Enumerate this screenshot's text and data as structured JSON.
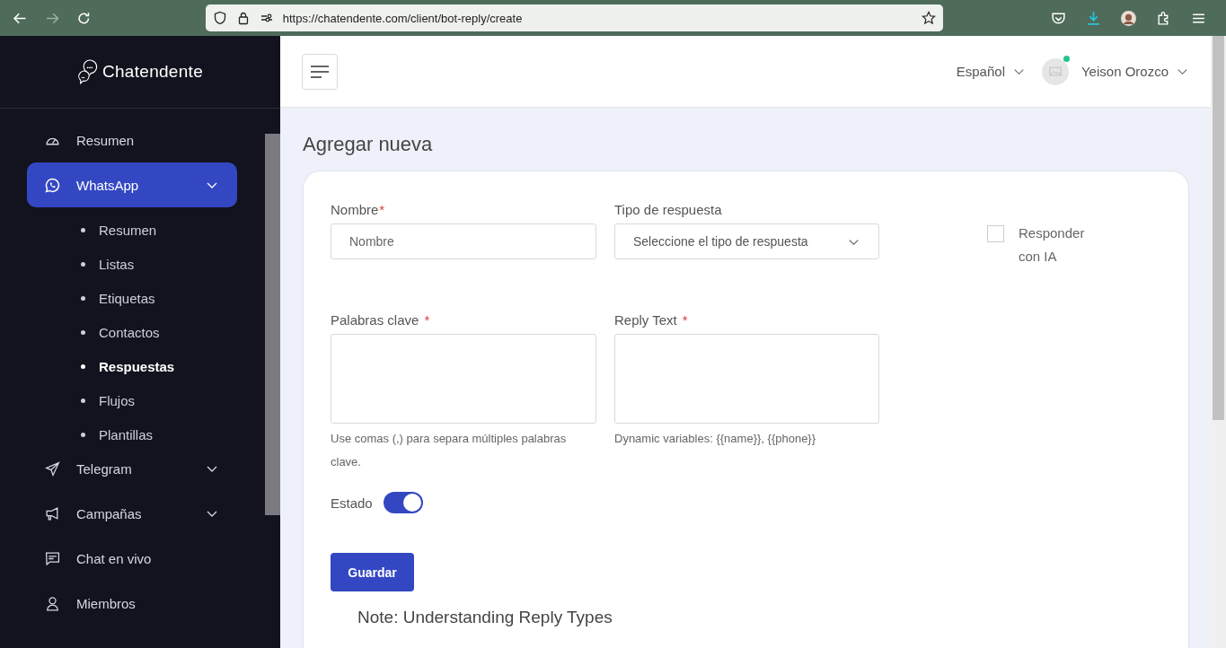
{
  "browser": {
    "url": "https://chatendente.com/client/bot-reply/create",
    "forward_disabled": true
  },
  "sidebar": {
    "logo": "Chatendente",
    "items": [
      {
        "label": "Resumen",
        "selected": false,
        "kind": "link"
      },
      {
        "label": "WhatsApp",
        "selected": true,
        "kind": "group",
        "children": [
          {
            "label": "Resumen",
            "selected": false
          },
          {
            "label": "Listas",
            "selected": false
          },
          {
            "label": "Etiquetas",
            "selected": false
          },
          {
            "label": "Contactos",
            "selected": false
          },
          {
            "label": "Respuestas",
            "selected": true
          },
          {
            "label": "Flujos",
            "selected": false
          },
          {
            "label": "Plantillas",
            "selected": false
          }
        ]
      },
      {
        "label": "Telegram",
        "selected": false,
        "kind": "group"
      },
      {
        "label": "Campañas",
        "selected": false,
        "kind": "group"
      },
      {
        "label": "Chat en vivo",
        "selected": false,
        "kind": "link"
      },
      {
        "label": "Miembros",
        "selected": false,
        "kind": "link"
      }
    ]
  },
  "header": {
    "language": "Español",
    "user": "Yeison Orozco",
    "online": true
  },
  "page": {
    "title": "Agregar nueva"
  },
  "form": {
    "fields": [
      {
        "kind": "text",
        "label": "Nombre",
        "required_mark": "*",
        "placeholder": "Nombre"
      },
      {
        "kind": "select",
        "label": "Tipo de respuesta",
        "placeholder": "Seleccione el tipo de respuesta"
      },
      {
        "kind": "checkbox",
        "label": "Responder con IA",
        "checked": false
      },
      {
        "kind": "textarea",
        "label": "Palabras clave",
        "required_mark": "*",
        "hint": "Use comas (,) para separa múltiples palabras clave."
      },
      {
        "kind": "textarea",
        "label": "Reply Text",
        "required_mark": "*",
        "hint": "Dynamic variables: {{name}}, {{phone}}"
      }
    ],
    "status": {
      "label": "Estado",
      "on": true
    },
    "submit": "Guardar",
    "note": "Note: Understanding Reply Types"
  }
}
